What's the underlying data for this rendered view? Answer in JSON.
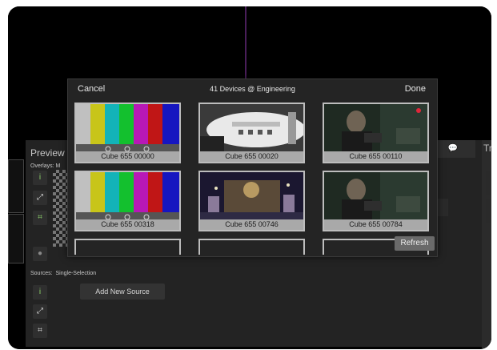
{
  "modal": {
    "cancel_label": "Cancel",
    "title": "41 Devices @ Engineering",
    "done_label": "Done",
    "refresh_label": "Refresh",
    "devices": [
      {
        "name": "Cube 655 00000",
        "thumb": "color-bars"
      },
      {
        "name": "Cube 655 00020",
        "thumb": "white-device"
      },
      {
        "name": "Cube 655 00110",
        "thumb": "person-dark"
      },
      {
        "name": "Cube 655 00318",
        "thumb": "color-bars"
      },
      {
        "name": "Cube 655 00746",
        "thumb": "ornate-scene"
      },
      {
        "name": "Cube 655 00784",
        "thumb": "person-dark"
      }
    ]
  },
  "preview": {
    "title": "Preview",
    "overlays_label": "Overlays:",
    "overlays_value": "M"
  },
  "sources": {
    "label": "Sources:",
    "mode": "Single-Selection",
    "add_label": "Add New Source"
  },
  "right_panel": {
    "letter": "Tr"
  },
  "colors": {
    "accent_green": "#8dd36b",
    "record_red": "#e0263a"
  }
}
